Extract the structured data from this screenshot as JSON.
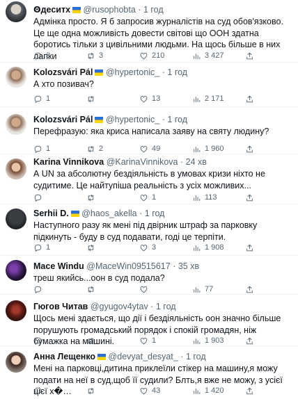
{
  "tweets": [
    {
      "name": "Ꙩдеситх",
      "flag": "ua",
      "handle": "@rusophobta",
      "time": "1 год",
      "text": "Адмінка просто. Я б запросив журналістів на суд обов'язково. Це ще одна можливість довести світові що ООН здатна боротись тільки з цивільними людьми. На щось більше в них лапки",
      "replies": "3",
      "retweets": "3",
      "likes": "210",
      "views": "3 427"
    },
    {
      "name": "Kolozsvári Pál",
      "flag": "ua",
      "handle": "@hypertonic_",
      "time": "1 год",
      "text": "А хто позивач?",
      "replies": "1",
      "retweets": "",
      "likes": "13",
      "views": "2 171"
    },
    {
      "name": "Kolozsvári Pál",
      "flag": "ua",
      "handle": "@hypertonic_",
      "time": "1 год",
      "text": "Перефразую: яка криса написала заяву на святу людину?",
      "replies": "1",
      "retweets": "2",
      "likes": "49",
      "views": "1 960"
    },
    {
      "name": "Karina Vinnikova",
      "flag": "",
      "handle": "@KarinaVinnikova",
      "time": "24 хв",
      "text": "А UN за абсолютну бездіяльність в умовах кризи ніхто не судитиме. Це найтупіша реальність з усіх можливих...",
      "replies": "",
      "retweets": "",
      "likes": "1",
      "views": "113"
    },
    {
      "name": "Serhii D.",
      "flag": "ua",
      "handle": "@haos_akella",
      "time": "1 год",
      "text": "Наступного разу як мені під двірник штраф за парковку підкинуть - буду в суд подавати, годі це терпіти.",
      "replies": "1",
      "retweets": "",
      "likes": "3",
      "views": "1 908"
    },
    {
      "name": "Mace Windu",
      "flag": "",
      "handle": "@MaceWin09515617",
      "time": "35 хв",
      "text": "треш якийсь...оон в суд подала?",
      "replies": "",
      "retweets": "",
      "likes": "",
      "views": "77"
    },
    {
      "name": "Гюгов Читав",
      "flag": "",
      "handle": "@gyugov4ytav",
      "time": "1 год",
      "text": "Щось мені здається, що дії і бездіяльність оон значно більше порушують громадський порядок і спокій громадян, ніж бумажка на машині.",
      "replies": "",
      "retweets": "",
      "likes": "1",
      "views": "1 903"
    },
    {
      "name": "Анна Лещенко",
      "flag": "ua",
      "handle": "@devyat_desyat_",
      "time": "1 год",
      "text": "Мені на парковці,дитина приклеїли стікер на машину,я можу подати на неї в суд,щоб її судили? Блть,я вже не можу, з усієї цієї х�…",
      "replies": "",
      "retweets": "",
      "likes": "43",
      "views": "1 420"
    }
  ],
  "icons": {
    "reply": "reply-icon",
    "retweet": "retweet-icon",
    "like": "heart-icon",
    "views": "views-icon",
    "share": "share-icon"
  }
}
